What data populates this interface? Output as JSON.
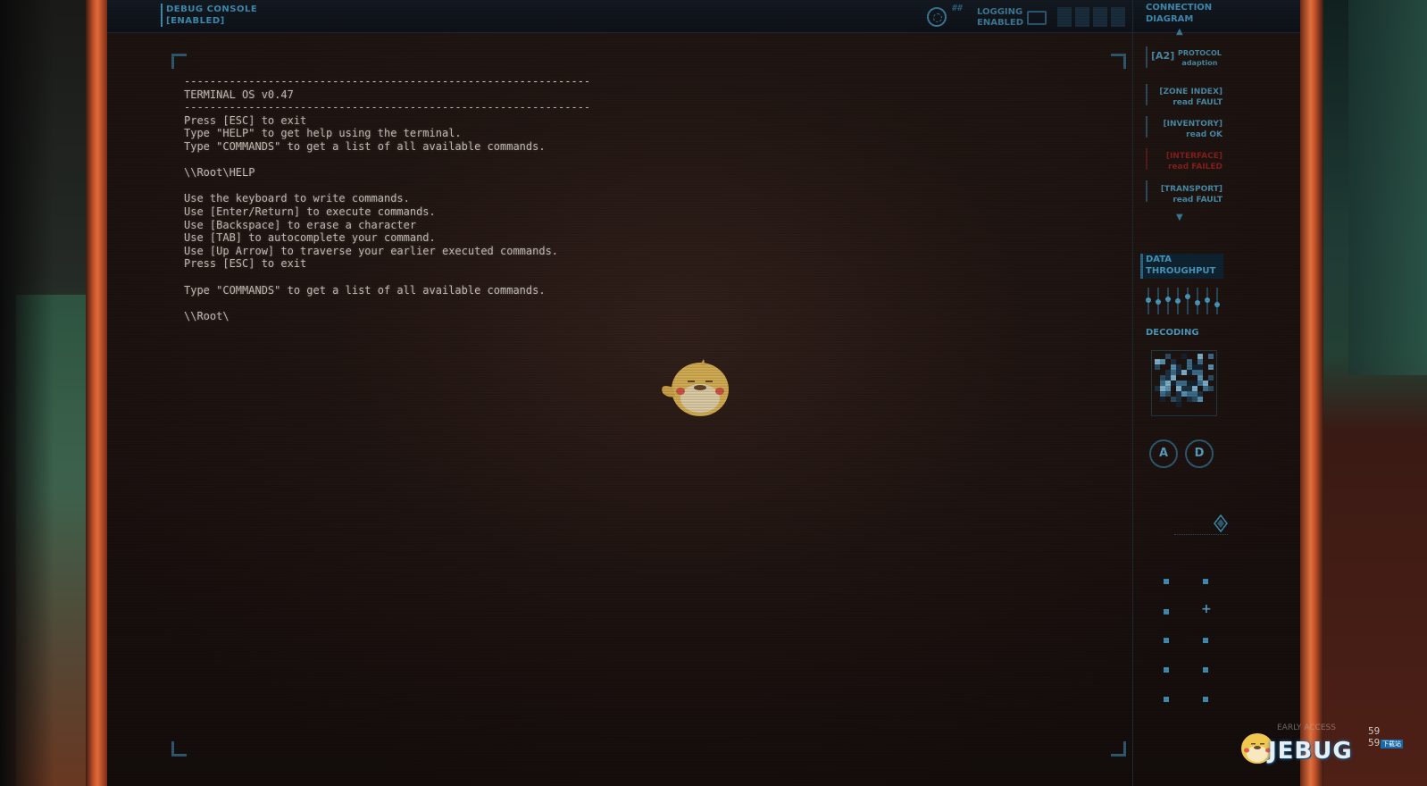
{
  "top_bar": {
    "debug_title": "DEBUG CONSOLE",
    "debug_status": "[ENABLED]",
    "hash": "##",
    "logging_label": "LOGGING",
    "logging_status": "ENABLED"
  },
  "terminal": {
    "lines": [
      "---------------------------------------------------------------",
      "TERMINAL OS v0.47",
      "---------------------------------------------------------------",
      "Press [ESC] to exit",
      "Type \"HELP\" to get help using the terminal.",
      "Type \"COMMANDS\" to get a list of all available commands.",
      "",
      "\\\\Root\\HELP",
      "",
      "Use the keyboard to write commands.",
      "Use [Enter/Return] to execute commands.",
      "Use [Backspace] to erase a character",
      "Use [TAB] to autocomplete your command.",
      "Use [Up Arrow] to traverse your earlier executed commands.",
      "Press [ESC] to exit",
      "",
      "Type \"COMMANDS\" to get a list of all available commands.",
      "",
      "\\\\Root\\"
    ]
  },
  "right_panel": {
    "connection_title_1": "CONNECTION",
    "connection_title_2": "DIAGRAM",
    "a2_label": "[A2]",
    "a2_sub_1": "PROTOCOL",
    "a2_sub_2": "adaption",
    "items": [
      {
        "name": "[ZONE INDEX]",
        "status": "read FAULT",
        "state": "fault"
      },
      {
        "name": "[INVENTORY]",
        "status": "read OK",
        "state": "ok"
      },
      {
        "name": "[INTERFACE]",
        "status": "read FAILED",
        "state": "failed"
      },
      {
        "name": "[TRANSPORT]",
        "status": "read FAULT",
        "state": "fault"
      }
    ],
    "data_throughput_1": "DATA",
    "data_throughput_2": "THROUGHPUT",
    "throughput_levels": [
      0.55,
      0.45,
      0.6,
      0.5,
      0.7,
      0.4,
      0.55,
      0.35
    ],
    "decoding_title": "DECODING",
    "button_a": "A",
    "button_d": "D"
  },
  "watermark": {
    "early_access_1": "EARLY ACCESS",
    "fps_1": "59",
    "fps_2": "59",
    "logo_text": "JEBUG",
    "logo_sub": "下载站"
  },
  "colors": {
    "accent_blue": "#3f8fb4",
    "fault_red": "#8a1f1a",
    "terminal_text": "#c9c2bb",
    "bezel_orange": "#e06a3a"
  }
}
